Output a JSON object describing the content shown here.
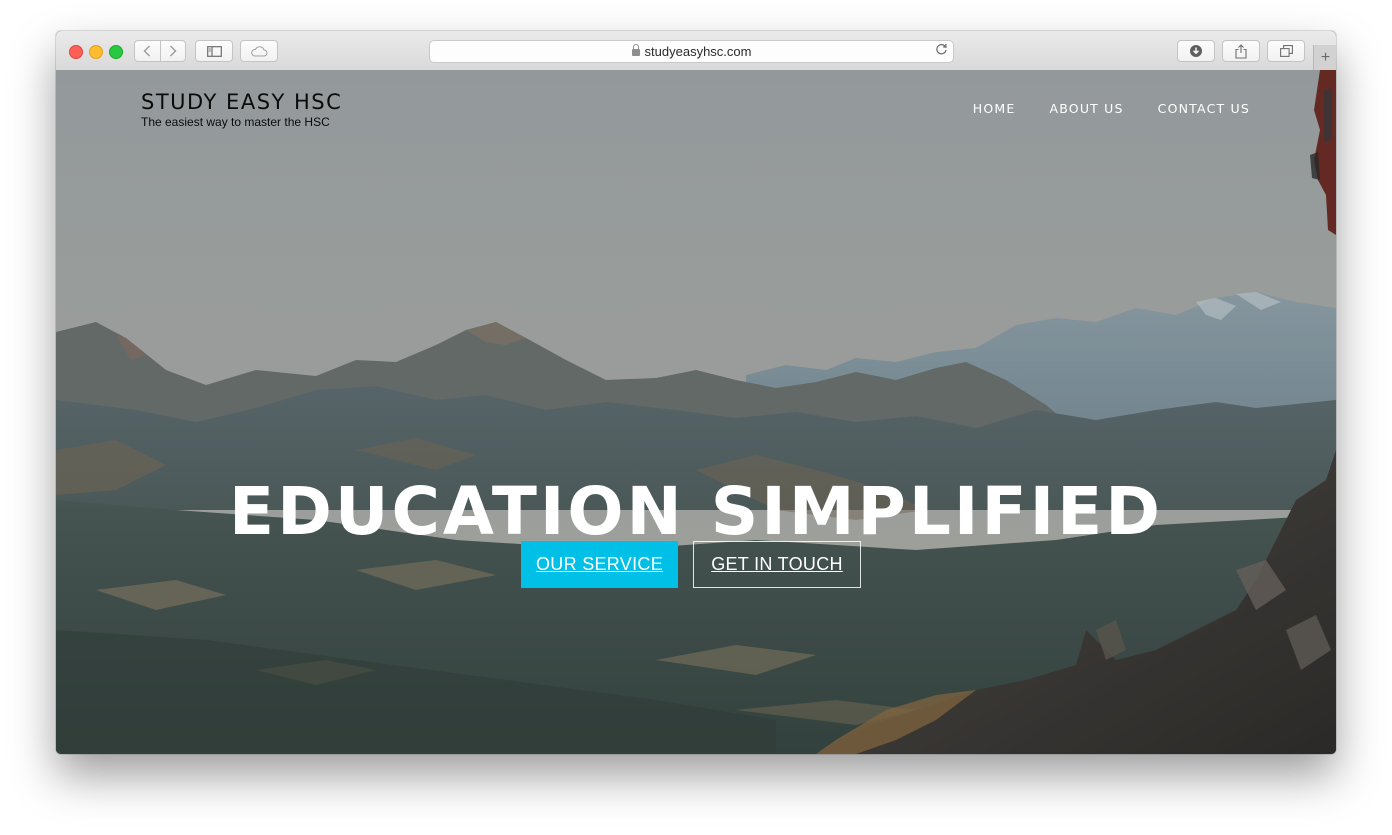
{
  "browser": {
    "url": "studyeasyhsc.com",
    "new_tab_label": "+"
  },
  "site": {
    "title": "STUDY EASY HSC",
    "tagline": "The easiest way to master the HSC"
  },
  "nav": {
    "items": [
      {
        "label": "HOME"
      },
      {
        "label": "ABOUT US"
      },
      {
        "label": "CONTACT US"
      }
    ]
  },
  "hero": {
    "headline": "EDUCATION SIMPLIFIED",
    "primary_button": "OUR SERVICE",
    "secondary_button": "GET IN TOUCH"
  },
  "colors": {
    "accent": "#00c0e8",
    "text_light": "#ffffff"
  }
}
